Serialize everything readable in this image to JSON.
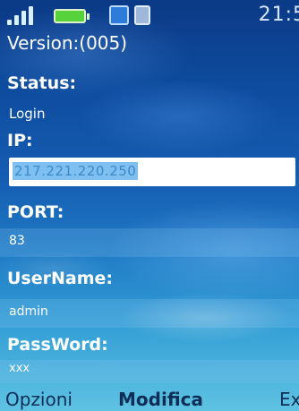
{
  "statusbar": {
    "time": "21:5",
    "signal_icon": "signal-bars-icon",
    "battery_icon": "battery-icon",
    "battery_color": "#58d23a"
  },
  "header": {
    "version": "Version:(005)"
  },
  "form": {
    "status": {
      "label": "Status:",
      "value": "Login"
    },
    "ip": {
      "label": "IP:",
      "value": "217.221.220.250"
    },
    "port": {
      "label": "PORT:",
      "value": "83"
    },
    "username": {
      "label": "UserName:",
      "value": "admin"
    },
    "password": {
      "label": "PassWord:",
      "value": "xxx"
    }
  },
  "softkeys": {
    "left": "Opzioni",
    "center": "Modifica",
    "right": "Ex"
  },
  "colors": {
    "selection": "#7fc0f0",
    "background_top": "#0b3a86",
    "background_bottom": "#5ec2e2"
  }
}
